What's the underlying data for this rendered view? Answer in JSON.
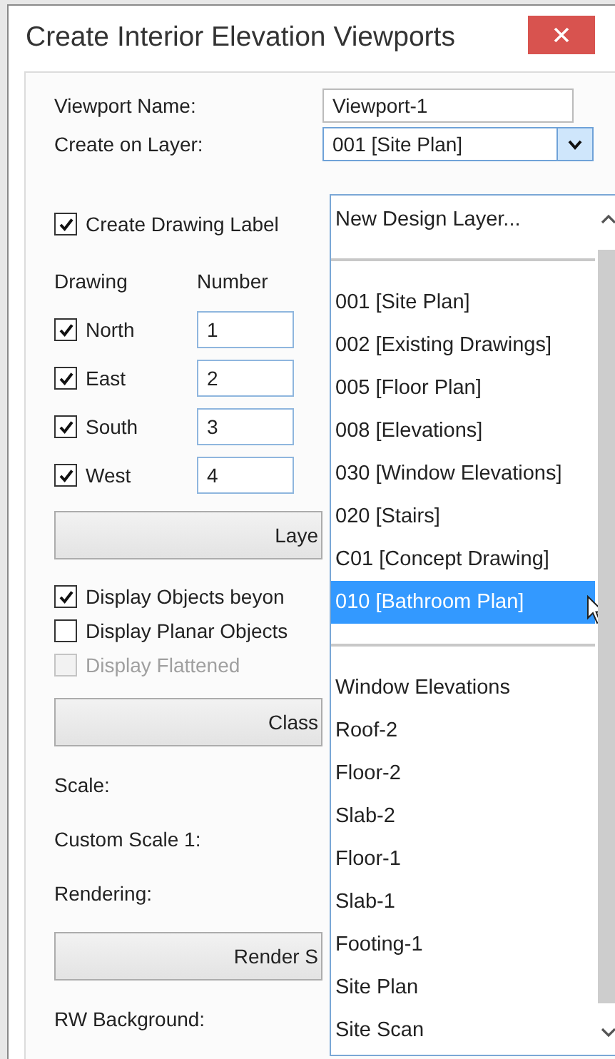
{
  "window": {
    "title": "Create Interior Elevation Viewports"
  },
  "viewport_name": {
    "label": "Viewport Name:",
    "value": "Viewport-1"
  },
  "layer": {
    "label": "Create on Layer:",
    "value": "001 [Site Plan]",
    "expanded": true
  },
  "drawing_label": {
    "label": "Create Drawing Label",
    "checked": true
  },
  "columns": [
    "Drawing",
    "Number"
  ],
  "directions": [
    {
      "label": "North",
      "checked": true,
      "number": "1"
    },
    {
      "label": "East",
      "checked": true,
      "number": "2"
    },
    {
      "label": "South",
      "checked": true,
      "number": "3"
    },
    {
      "label": "West",
      "checked": true,
      "number": "4"
    }
  ],
  "settings": [
    {
      "kind": "button",
      "label": "Laye"
    },
    {
      "kind": "check",
      "label": "Display Objects beyon",
      "checked": true,
      "disabled": false
    },
    {
      "kind": "check",
      "label": "Display Planar Objects",
      "checked": false,
      "disabled": false
    },
    {
      "kind": "check",
      "label": "Display Flattened",
      "checked": false,
      "disabled": true
    },
    {
      "kind": "button",
      "label": "Class"
    },
    {
      "kind": "label",
      "label": "Scale:"
    },
    {
      "kind": "label",
      "label": "Custom Scale 1:"
    },
    {
      "kind": "label",
      "label": "Rendering:"
    },
    {
      "kind": "button",
      "label": "Render S"
    },
    {
      "kind": "label",
      "label": "RW Background:"
    }
  ],
  "dropdown": {
    "groups": [
      {
        "items": [
          {
            "label": "New Design Layer...",
            "selected": false
          }
        ]
      },
      {
        "items": [
          {
            "label": "001 [Site Plan]",
            "selected": false
          },
          {
            "label": "002 [Existing Drawings]",
            "selected": false
          },
          {
            "label": "005 [Floor Plan]",
            "selected": false
          },
          {
            "label": "008 [Elevations]",
            "selected": false
          },
          {
            "label": "030 [Window Elevations]",
            "selected": false
          },
          {
            "label": "020 [Stairs]",
            "selected": false
          },
          {
            "label": "C01 [Concept Drawing]",
            "selected": false
          },
          {
            "label": "010 [Bathroom Plan]",
            "selected": true
          }
        ]
      },
      {
        "items": [
          {
            "label": "Window Elevations",
            "selected": false
          },
          {
            "label": "Roof-2",
            "selected": false
          },
          {
            "label": "Floor-2",
            "selected": false
          },
          {
            "label": "Slab-2",
            "selected": false
          },
          {
            "label": "Floor-1",
            "selected": false
          },
          {
            "label": "Slab-1",
            "selected": false
          },
          {
            "label": "Footing-1",
            "selected": false
          },
          {
            "label": "Site Plan",
            "selected": false
          },
          {
            "label": "Site Scan",
            "selected": false
          }
        ]
      }
    ]
  }
}
